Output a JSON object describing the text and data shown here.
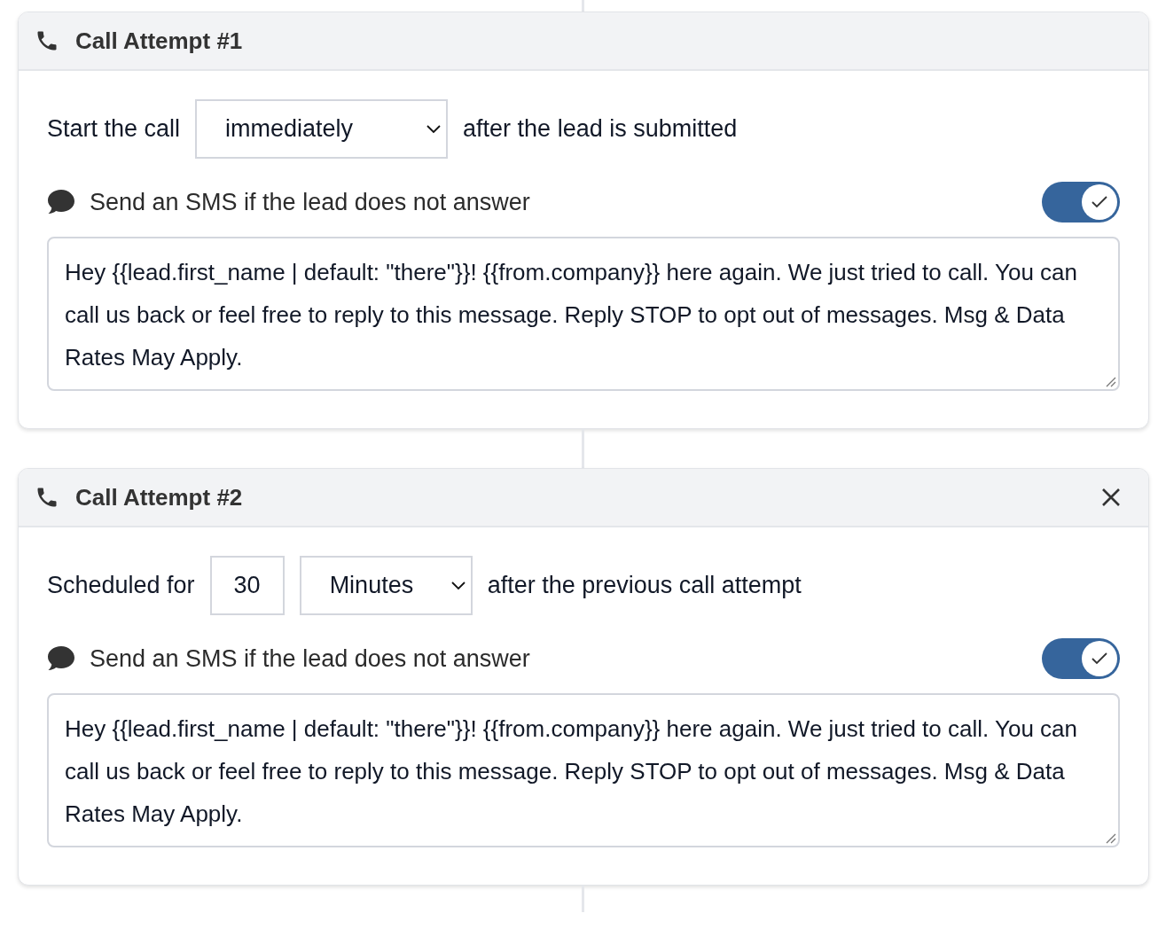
{
  "attempts": [
    {
      "title": "Call Attempt #1",
      "removable": false,
      "timing": {
        "kind": "select",
        "prefix": "Start the call",
        "unit": "immediately",
        "suffix": "after the lead is submitted"
      },
      "sms": {
        "label": "Send an SMS if the lead does not answer",
        "on": true,
        "message": "Hey {{lead.first_name | default: \"there\"}}! {{from.company}} here again. We just tried to call. You can call us back or feel free to reply to this message. Reply STOP to opt out of messages. Msg & Data Rates May Apply."
      }
    },
    {
      "title": "Call Attempt #2",
      "removable": true,
      "timing": {
        "kind": "amount",
        "prefix": "Scheduled for",
        "amount": "30",
        "unit": "Minutes",
        "suffix": "after the previous call attempt"
      },
      "sms": {
        "label": "Send an SMS if the lead does not answer",
        "on": true,
        "message": "Hey {{lead.first_name | default: \"there\"}}! {{from.company}} here again. We just tried to call. You can call us back or feel free to reply to this message. Reply STOP to opt out of messages. Msg & Data Rates May Apply."
      }
    }
  ]
}
